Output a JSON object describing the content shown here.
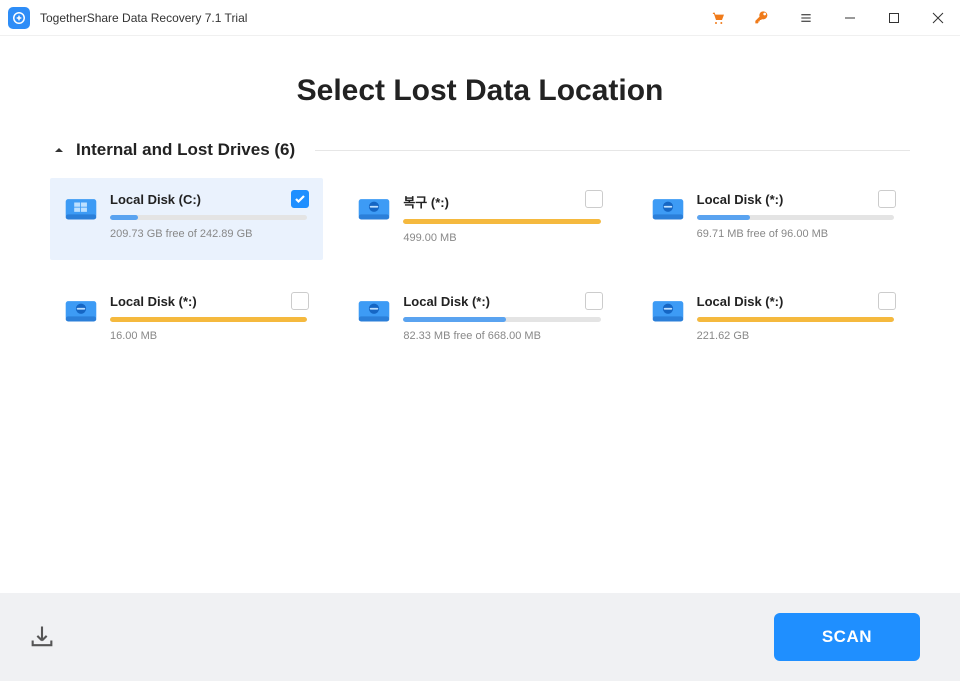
{
  "window": {
    "title": "TogetherShare Data Recovery 7.1 Trial"
  },
  "page": {
    "title": "Select Lost Data Location"
  },
  "section": {
    "title": "Internal and Lost Drives (6)"
  },
  "drives": [
    {
      "name": "Local Disk (C:)",
      "stats": "209.73 GB free of 242.89 GB",
      "fill": 14,
      "color": "blue",
      "selected": true
    },
    {
      "name": "복구 (*:)",
      "stats": "499.00 MB",
      "fill": 100,
      "color": "orange",
      "selected": false
    },
    {
      "name": "Local Disk (*:)",
      "stats": "69.71 MB free of 96.00 MB",
      "fill": 27,
      "color": "blue",
      "selected": false
    },
    {
      "name": "Local Disk (*:)",
      "stats": "16.00 MB",
      "fill": 100,
      "color": "orange",
      "selected": false
    },
    {
      "name": "Local Disk (*:)",
      "stats": "82.33 MB free of 668.00 MB",
      "fill": 52,
      "color": "blue",
      "selected": false
    },
    {
      "name": "Local Disk (*:)",
      "stats": "221.62 GB",
      "fill": 100,
      "color": "orange",
      "selected": false
    }
  ],
  "footer": {
    "scan_label": "SCAN"
  }
}
